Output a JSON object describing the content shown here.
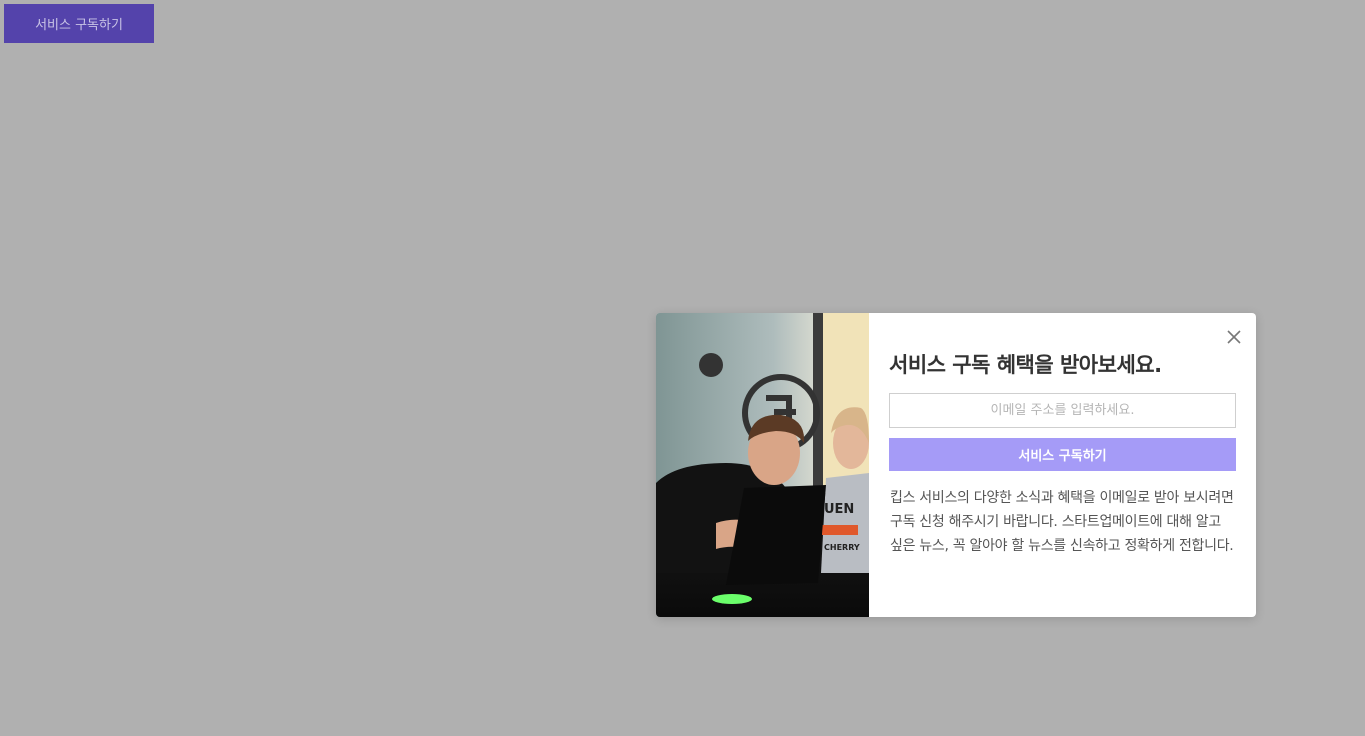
{
  "top_button": {
    "label": "서비스 구독하기"
  },
  "modal": {
    "image_alt": "people working at laptops",
    "title": "서비스 구독 혜택을 받아보세요.",
    "email_placeholder": "이메일 주소를 입력하세요.",
    "email_value": "",
    "subscribe_label": "서비스 구독하기",
    "description": "킵스 서비스의 다양한 소식과 혜택을 이메일로 받아 보시려면 구독 신청 해주시기 바랍니다. 스타트업메이트에 대해 알고 싶은 뉴스, 꼭 알아야 할 뉴스를 신속하고 정확하게 전합니다.",
    "close_icon": "close-icon"
  },
  "colors": {
    "backdrop": "#b0b0b0",
    "top_button_bg": "#5443ab",
    "subscribe_button_bg": "#a59bf7",
    "title_text": "#333333"
  }
}
